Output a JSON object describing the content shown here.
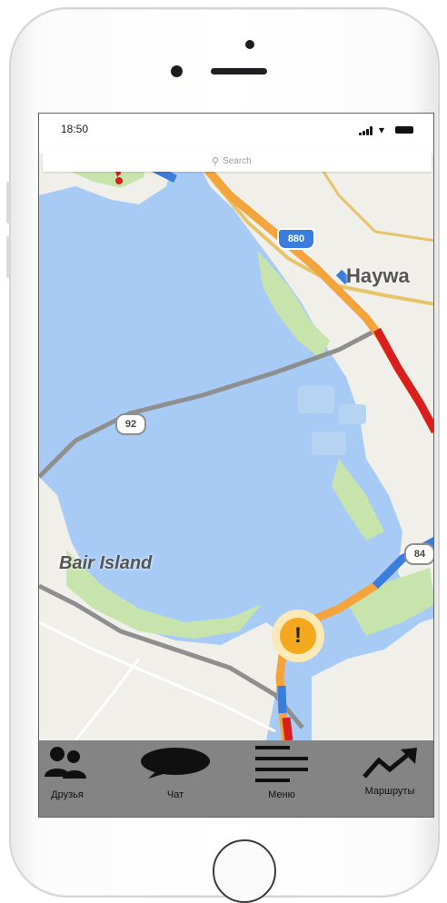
{
  "status_bar": {
    "time": "18:50"
  },
  "search": {
    "placeholder": "Search"
  },
  "map": {
    "place_labels": [
      "Haywa",
      "Bair Island"
    ],
    "highway_shields": [
      "880",
      "92",
      "84"
    ],
    "alert_marker": "!"
  },
  "tab_bar": {
    "items": [
      {
        "label": "Друзья",
        "icon": "people-icon"
      },
      {
        "label": "Чат",
        "icon": "chat-bubble-icon"
      },
      {
        "label": "Меню",
        "icon": "hamburger-menu-icon"
      },
      {
        "label": "Маршруты",
        "icon": "trend-arrow-icon"
      }
    ]
  },
  "colors": {
    "water": "#a8cbf6",
    "land": "#f1efe9",
    "park": "#c7e4ad",
    "traffic_orange": "#f3a43b",
    "traffic_red": "#d91e1e",
    "tab_bar": "#848484"
  }
}
